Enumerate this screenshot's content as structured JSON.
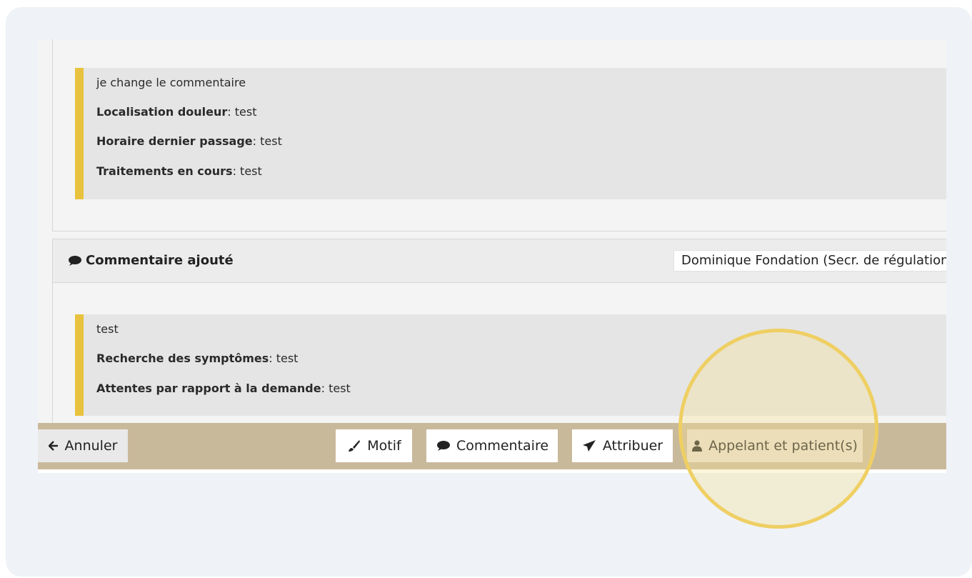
{
  "entry_top": {
    "lines": [
      {
        "label": "",
        "value": "je change le commentaire"
      },
      {
        "label": "Localisation douleur",
        "value": ": test"
      },
      {
        "label": "Horaire dernier passage",
        "value": ": test"
      },
      {
        "label": "Traitements en cours",
        "value": ": test"
      }
    ]
  },
  "entry_comment": {
    "title": "Commentaire ajouté",
    "author": "Dominique Fondation (Secr. de régulation",
    "lines": [
      {
        "label": "",
        "value": "test"
      },
      {
        "label": "Recherche des symptômes",
        "value": ": test"
      },
      {
        "label": "Attentes par rapport à la demande",
        "value": ": test"
      }
    ]
  },
  "toolbar": {
    "cancel_label": "Annuler",
    "motif_label": "Motif",
    "comment_label": "Commentaire",
    "assign_label": "Attribuer",
    "callers_label": "Appelant et patient(s)"
  },
  "icons": {
    "cancel": "arrow-left-icon",
    "motif": "brush-icon",
    "comment": "speech-bubble-icon",
    "assign": "paper-plane-icon",
    "callers": "user-icon"
  },
  "colors": {
    "accent_bar": "#e8c23e",
    "toolbar_bg": "#c9b99b",
    "highlight_ring": "#efcf63"
  }
}
